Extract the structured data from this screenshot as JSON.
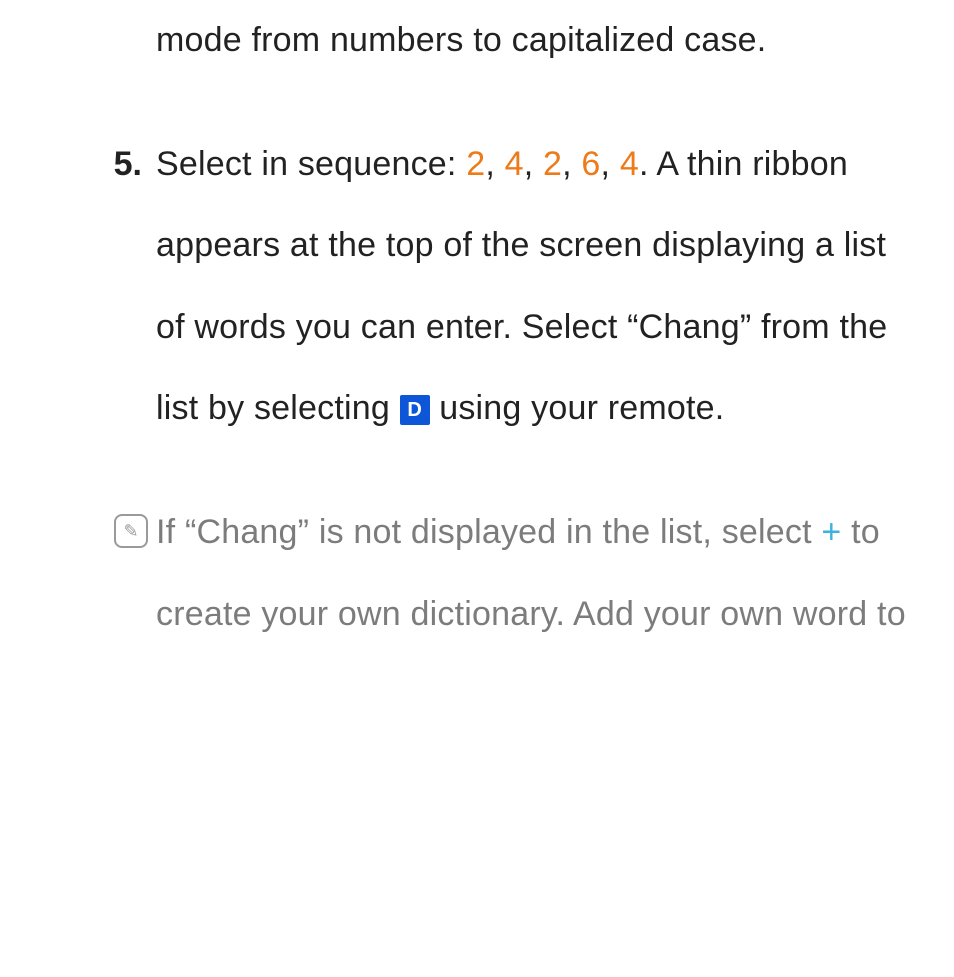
{
  "item4": {
    "text_tail": "mode from numbers to capitalized case."
  },
  "item5": {
    "number": "5.",
    "pre_seq": "Select in sequence: ",
    "seq": [
      "2",
      "4",
      "2",
      "6",
      "4"
    ],
    "sep": ", ",
    "after_seq": ". A thin ribbon appears at the top of the screen displaying a list of words you can enter. Select “Chang” from the list by selecting ",
    "d_badge": "D",
    "after_badge": " using your remote."
  },
  "note": {
    "icon": "✎",
    "pre_plus": "If “Chang” is not displayed in the list, select ",
    "plus": "+",
    "after_plus": " to create your own dictionary. Add your own word to"
  }
}
